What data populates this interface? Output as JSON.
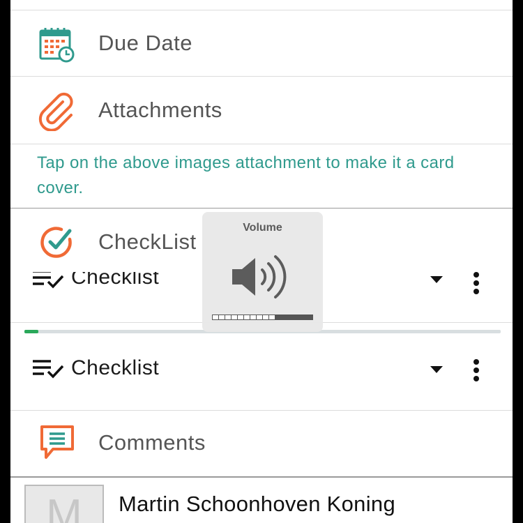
{
  "rows": {
    "due_date": {
      "label": "Due Date",
      "icon": "calendar-clock-icon"
    },
    "attachments": {
      "label": "Attachments",
      "icon": "paperclip-icon"
    },
    "hint": "Tap on the above images attachment to make it a card cover.",
    "checklist_header": {
      "label": "CheckList",
      "icon": "check-circle-icon"
    },
    "checklists": [
      {
        "label": "Checklist",
        "icon": "checklist-lines-icon",
        "progress": 0.03
      },
      {
        "label": "Checklist",
        "icon": "checklist-lines-icon"
      }
    ],
    "comments": {
      "label": "Comments",
      "icon": "speech-bubble-icon"
    }
  },
  "comment": {
    "avatar_letter": "M",
    "author": "Martin Schoonhoven Koning"
  },
  "volume_hud": {
    "title": "Volume",
    "level": 0.6,
    "icon": "speaker-icon"
  },
  "colors": {
    "teal": "#2f9a8d",
    "orange": "#f06a36",
    "progress": "#2aa85a"
  }
}
